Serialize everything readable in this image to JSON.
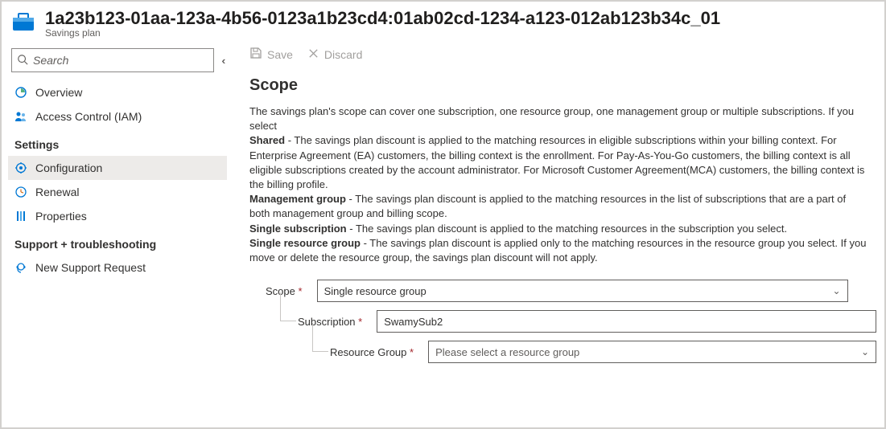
{
  "header": {
    "title": "1a23b123-01aa-123a-4b56-0123a1b23cd4:01ab02cd-1234-a123-012ab123b34c_01",
    "subtitle": "Savings plan"
  },
  "sidebar": {
    "search_placeholder": "Search",
    "items": [
      {
        "label": "Overview",
        "icon": "overview"
      },
      {
        "label": "Access Control (IAM)",
        "icon": "people"
      }
    ],
    "settings_header": "Settings",
    "settings_items": [
      {
        "label": "Configuration",
        "icon": "gear",
        "selected": true
      },
      {
        "label": "Renewal",
        "icon": "clock"
      },
      {
        "label": "Properties",
        "icon": "props"
      }
    ],
    "support_header": "Support + troubleshooting",
    "support_items": [
      {
        "label": "New Support Request",
        "icon": "support"
      }
    ]
  },
  "toolbar": {
    "save_label": "Save",
    "discard_label": "Discard"
  },
  "main": {
    "section_title": "Scope",
    "intro": "The savings plan's scope can cover one subscription, one resource group, one management group or multiple subscriptions. If you select",
    "shared_label": "Shared",
    "shared_text": " - The savings plan discount is applied to the matching resources in eligible subscriptions within your billing context. For Enterprise Agreement (EA) customers, the billing context is the enrollment. For Pay-As-You-Go customers, the billing context is all eligible subscriptions created by the account administrator. For Microsoft Customer Agreement(MCA) customers, the billing context is the billing profile.",
    "mg_label": "Management group",
    "mg_text": " - The savings plan discount is applied to the matching resources in the list of subscriptions that are a part of both management group and billing scope.",
    "ss_label": "Single subscription",
    "ss_text": " - The savings plan discount is applied to the matching resources in the subscription you select.",
    "srg_label": "Single resource group",
    "srg_text": " - The savings plan discount is applied only to the matching resources in the resource group you select. If you move or delete the resource group, the savings plan discount will not apply.",
    "form": {
      "scope_label": "Scope",
      "scope_value": "Single resource group",
      "subscription_label": "Subscription",
      "subscription_value": "SwamySub2",
      "rg_label": "Resource Group",
      "rg_placeholder": "Please select a resource group"
    }
  }
}
